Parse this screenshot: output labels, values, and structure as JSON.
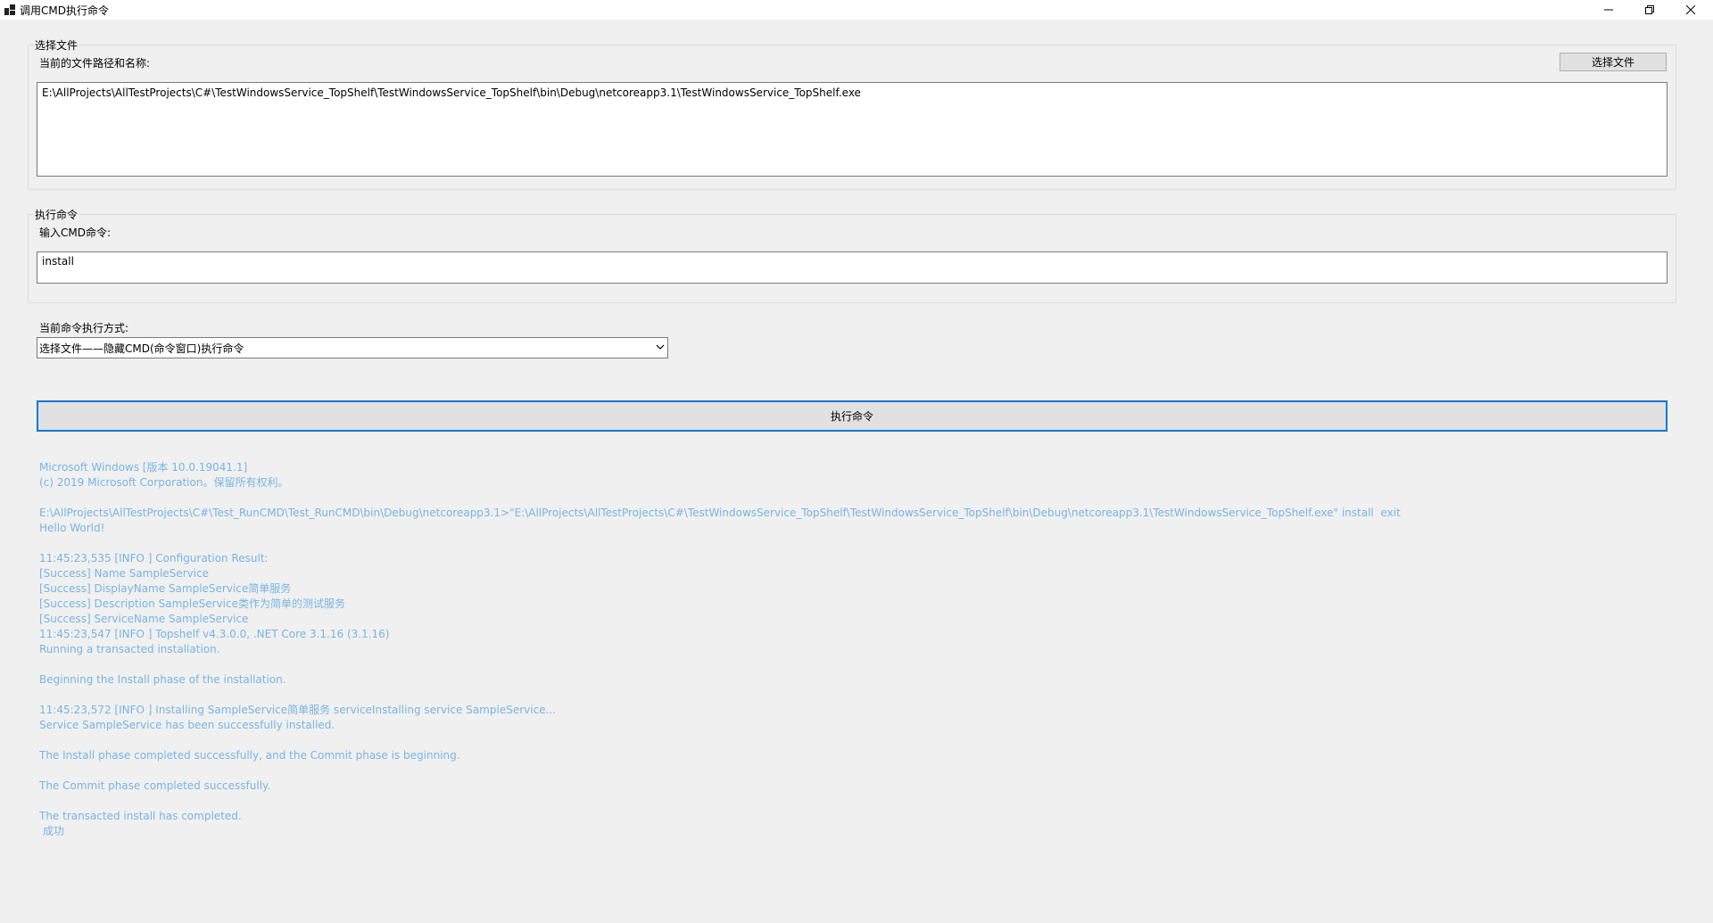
{
  "window": {
    "title": "调用CMD执行命令",
    "icon": "app-window-icon"
  },
  "file_group": {
    "legend": "选择文件",
    "path_label": "当前的文件路径和名称:",
    "select_button": "选择文件",
    "path_value": "E:\\AllProjects\\AllTestProjects\\C#\\TestWindowsService_TopShelf\\TestWindowsService_TopShelf\\bin\\Debug\\netcoreapp3.1\\TestWindowsService_TopShelf.exe"
  },
  "command_group": {
    "legend": "执行命令",
    "input_label": "输入CMD命令:",
    "input_value": "install"
  },
  "mode": {
    "label": "当前命令执行方式:",
    "selected": "选择文件——隐藏CMD(命令窗口)执行命令"
  },
  "execute_button": "执行命令",
  "output_lines": [
    "Microsoft Windows [版本 10.0.19041.1]",
    "(c) 2019 Microsoft Corporation。保留所有权利。",
    "",
    "E:\\AllProjects\\AllTestProjects\\C#\\Test_RunCMD\\Test_RunCMD\\bin\\Debug\\netcoreapp3.1>\"E:\\AllProjects\\AllTestProjects\\C#\\TestWindowsService_TopShelf\\TestWindowsService_TopShelf\\bin\\Debug\\netcoreapp3.1\\TestWindowsService_TopShelf.exe\" install  exit",
    "Hello World!",
    "",
    "11:45:23,535 [INFO ] Configuration Result:",
    "[Success] Name SampleService",
    "[Success] DisplayName SampleService简单服务",
    "[Success] Description SampleService类作为简单的测试服务",
    "[Success] ServiceName SampleService",
    "11:45:23,547 [INFO ] Topshelf v4.3.0.0, .NET Core 3.1.16 (3.1.16)",
    "Running a transacted installation.",
    "",
    "Beginning the Install phase of the installation.",
    "",
    "11:45:23,572 [INFO ] Installing SampleService简单服务 serviceInstalling service SampleService...",
    "Service SampleService has been successfully installed.",
    "",
    "The Install phase completed successfully, and the Commit phase is beginning.",
    "",
    "The Commit phase completed successfully.",
    "",
    "The transacted install has completed.",
    " 成功"
  ],
  "colors": {
    "window_bg": "#f0f0f0",
    "output_text": "#78b4e4",
    "accent_border": "#0078d7"
  }
}
